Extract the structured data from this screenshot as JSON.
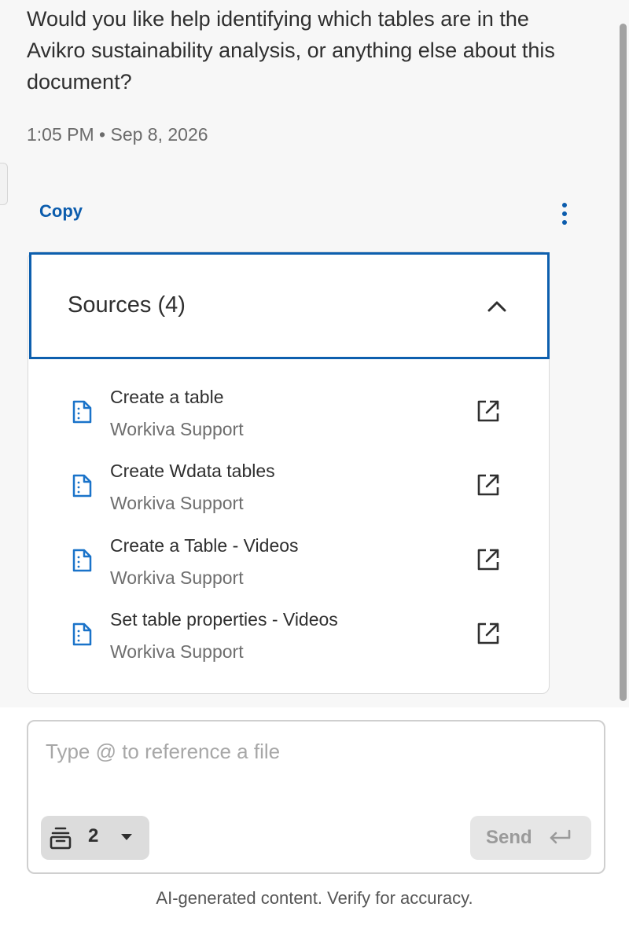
{
  "message": {
    "text": "Would you like help identifying which tables are in the Avikro sustainability analysis, or anything else about this document?",
    "timestamp": "1:05 PM • Sep 8, 2026"
  },
  "actions": {
    "copy_label": "Copy",
    "more_icon": "vertical-ellipsis-icon"
  },
  "sources": {
    "title": "Sources (4)",
    "expanded": true,
    "items": [
      {
        "title": "Create a table",
        "subtitle": "Workiva Support"
      },
      {
        "title": "Create Wdata tables",
        "subtitle": "Workiva Support"
      },
      {
        "title": "Create a Table - Videos",
        "subtitle": "Workiva Support"
      },
      {
        "title": "Set table properties - Videos",
        "subtitle": "Workiva Support"
      }
    ]
  },
  "composer": {
    "placeholder": "Type @ to reference a file",
    "value": "",
    "context_count": "2",
    "send_label": "Send"
  },
  "footer": {
    "disclaimer": "AI-generated content. Verify for accuracy."
  },
  "colors": {
    "accent": "#0d5fae",
    "link": "#0b5cad",
    "doc_icon": "#1a73c9"
  }
}
